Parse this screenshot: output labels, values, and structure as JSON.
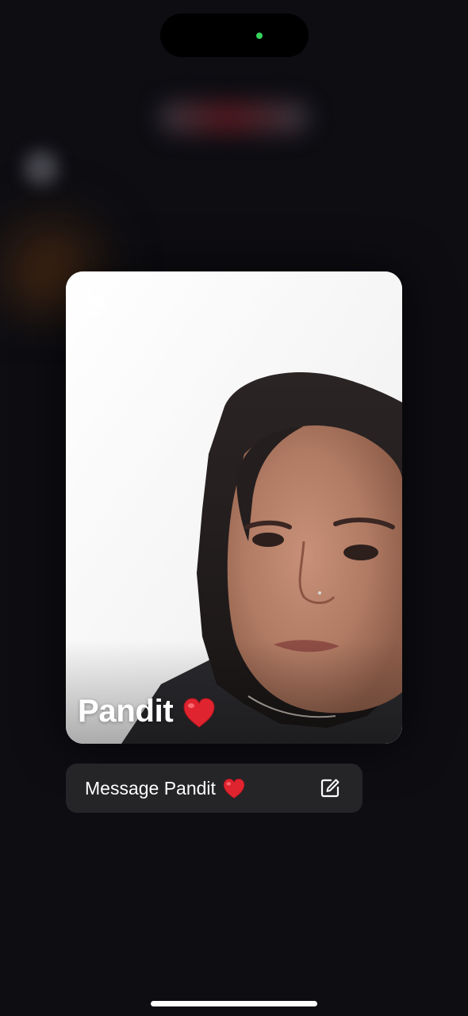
{
  "call": {
    "caller_name": "Pandit",
    "caller_emoji": "heart-emoji",
    "microphone_muted": true
  },
  "message_bar": {
    "label": "Message Pandit",
    "emoji": "heart-emoji",
    "action_icon": "compose-icon"
  },
  "status": {
    "camera_indicator": "green-dot"
  },
  "colors": {
    "background": "#0d0d12",
    "tile_background": "#f7f7f7",
    "message_bar": "#252528",
    "camera_indicator": "#36d35b",
    "heart": "#e0242f",
    "text": "#ffffff"
  }
}
